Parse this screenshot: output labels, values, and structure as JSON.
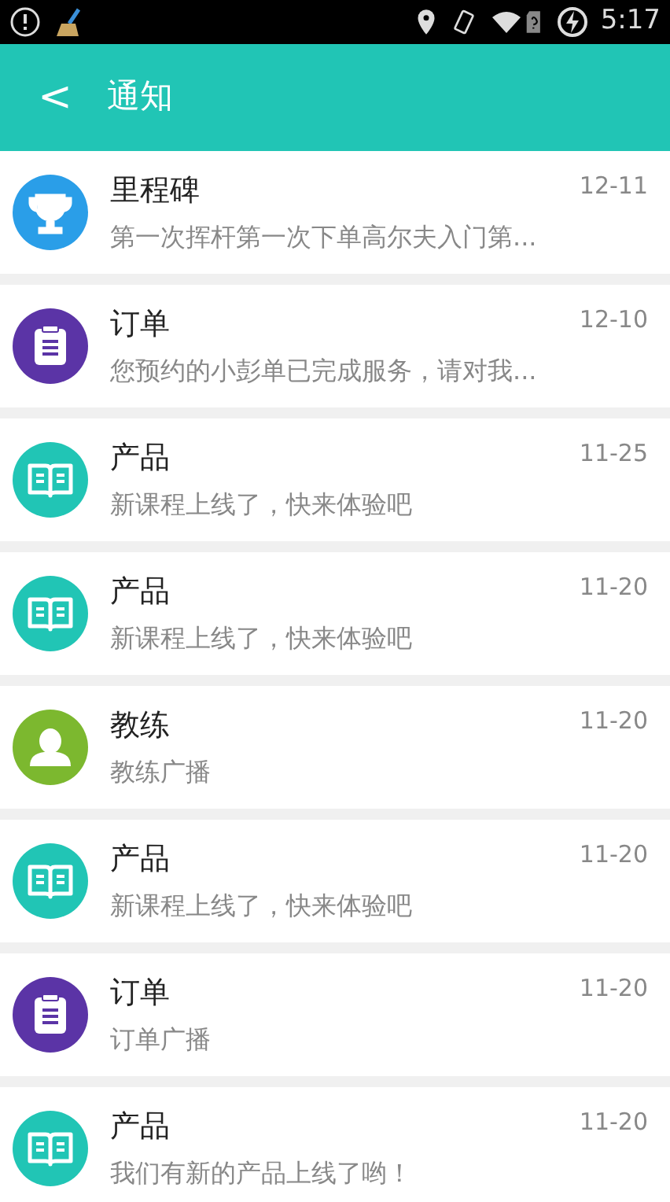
{
  "status_bar": {
    "time": "5:17"
  },
  "header": {
    "back": "<",
    "title": "通知"
  },
  "notifications": [
    {
      "kind": "milestone",
      "title": "里程碑",
      "date": "12-11",
      "message": "第一次挥杆第一次下单高尔夫入门第..."
    },
    {
      "kind": "order",
      "title": "订单",
      "date": "12-10",
      "message": "您预约的小彭单已完成服务，请对我..."
    },
    {
      "kind": "product",
      "title": "产品",
      "date": "11-25",
      "message": "新课程上线了，快来体验吧"
    },
    {
      "kind": "product",
      "title": "产品",
      "date": "11-20",
      "message": "新课程上线了，快来体验吧"
    },
    {
      "kind": "coach",
      "title": "教练",
      "date": "11-20",
      "message": "教练广播"
    },
    {
      "kind": "product",
      "title": "产品",
      "date": "11-20",
      "message": "新课程上线了，快来体验吧"
    },
    {
      "kind": "order",
      "title": "订单",
      "date": "11-20",
      "message": "订单广播"
    },
    {
      "kind": "product",
      "title": "产品",
      "date": "11-20",
      "message": "我们有新的产品上线了哟！"
    }
  ]
}
